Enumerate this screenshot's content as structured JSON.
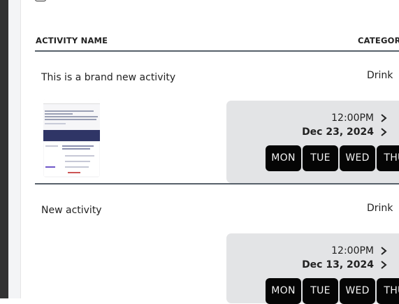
{
  "table": {
    "headers": {
      "activity_name": "ACTIVITY NAME",
      "category": "CATEGORY"
    }
  },
  "activities": [
    {
      "name": "This is a brand new activity",
      "category": "Drink",
      "time": "12:00PM",
      "date": "Dec 23, 2024",
      "days": [
        "MON",
        "TUE",
        "WED",
        "THU"
      ]
    },
    {
      "name": "New activity",
      "category": "Drink",
      "time": "12:00PM",
      "date": "Dec 13, 2024",
      "days": [
        "MON",
        "TUE",
        "WED",
        "THU"
      ]
    }
  ],
  "icons": {
    "chevron": "chevron-right-icon",
    "top_icon": "tray-icon"
  },
  "colors": {
    "day_bg": "#050505",
    "schedule_bg": "#e3e4e6",
    "divider": "#57616a"
  }
}
